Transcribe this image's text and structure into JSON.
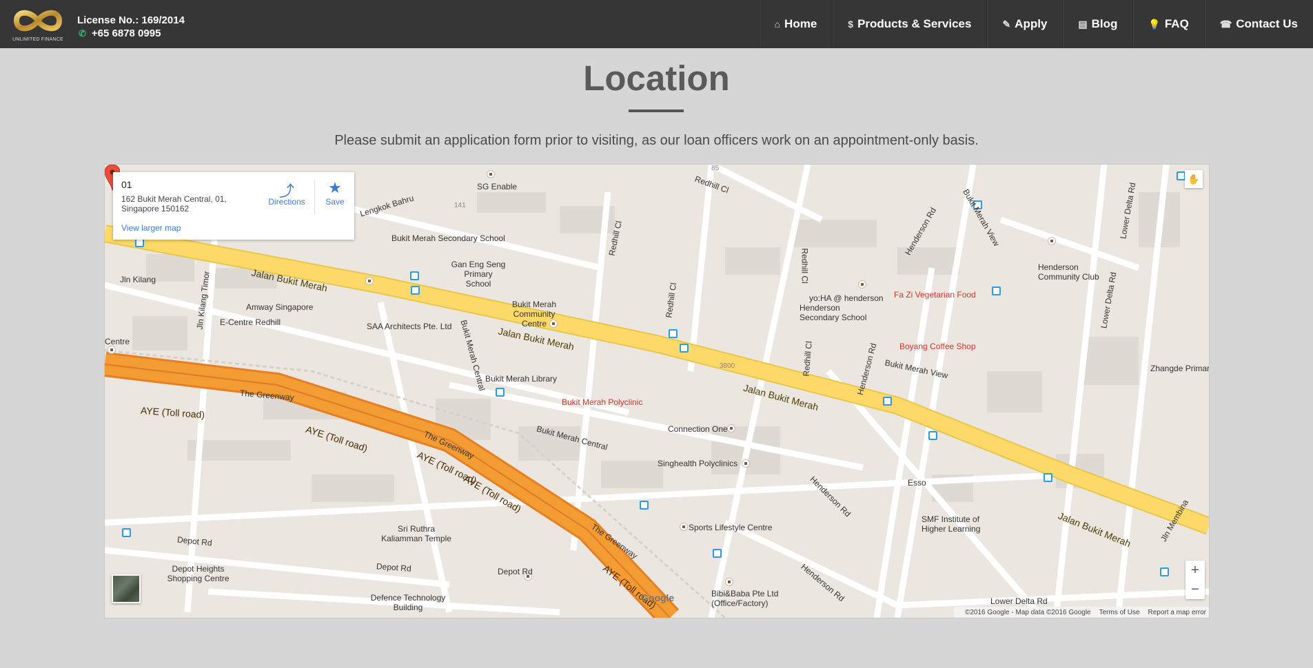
{
  "header": {
    "logo_text": "UNLIMITED FINANCE",
    "license": "License No.: 169/2014",
    "phone": "+65 6878 0995",
    "nav": [
      {
        "label": "Home",
        "icon": "home-icon"
      },
      {
        "label": "Products & Services",
        "icon": "dollar-icon"
      },
      {
        "label": "Apply",
        "icon": "edit-icon"
      },
      {
        "label": "Blog",
        "icon": "newspaper-icon"
      },
      {
        "label": "FAQ",
        "icon": "lightbulb-icon"
      },
      {
        "label": "Contact Us",
        "icon": "phone-icon"
      }
    ]
  },
  "page": {
    "title": "Location",
    "subtitle": "Please submit an application form prior to visiting, as our loan officers work on an appointment-only basis."
  },
  "map": {
    "info": {
      "title": "01",
      "address": "162 Bukit Merah Central, 01, Singapore 150162",
      "directions": "Directions",
      "save": "Save",
      "larger_map": "View larger map"
    },
    "labels": {
      "sg_enable": "SG Enable",
      "lengkok": "Lengkok Bahru",
      "bm_sec": "Bukit Merah Secondary School",
      "gan_eng": "Gan Eng Seng Primary School",
      "redhill_cl": "Redhill Cl",
      "jln_kilang": "Jln Kilang",
      "jln_kilang_timor": "Jln Kilang Timor",
      "amway": "Amway Singapore",
      "ecentre": "E-Centre Redhill",
      "centre": "Centre",
      "saa": "SAA Architects Pte. Ltd",
      "bm_comm": "Bukit Merah Community Centre",
      "jbm1": "Jalan Bukit Merah",
      "jbm2": "Jalan Bukit Merah",
      "jbm3": "Jalan Bukit Merah",
      "jbm4": "Jalan Bukit Merah",
      "bm_library": "Bukit Merah Library",
      "bm_poly": "Bukit Merah Polyclinic",
      "greenway1": "The Greenway",
      "greenway2": "The Greenway",
      "greenway3": "The Greenway",
      "aye1": "AYE (Toll road)",
      "aye2": "AYE (Toll road)",
      "aye3": "AYE (Toll road)",
      "aye4": "AYE (Toll road)",
      "aye5": "AYE (Toll road)",
      "bm_central1": "Bukit Merah Central",
      "bm_central2": "Bukit Merah Central",
      "connection_one": "Connection One",
      "singhealth": "Singhealth Polyclinics",
      "sports": "Sports Lifestyle Centre",
      "sri": "Sri Ruthra Kaliamman Temple",
      "depot1": "Depot Rd",
      "depot2": "Depot Rd",
      "depot3": "Depot Rd",
      "depot_heights": "Depot Heights Shopping Centre",
      "defence": "Defence Technology Building",
      "bibi": "Bibi&Baba Pte Ltd (Office/Factory)",
      "yoha": "yo:HA @ henderson",
      "henderson_sec": "Henderson Secondary School",
      "fazi": "Fa Zi Vegetarian Food",
      "boyang": "Boyang Coffee Shop",
      "bm_view1": "Bukit Merah View",
      "bm_view2": "Bukit Merah View",
      "henderson_cc": "Henderson Community Club",
      "lower_delta1": "Lower Delta Rd",
      "lower_delta2": "Lower Delta Rd",
      "lower_delta3": "Lower Delta Rd",
      "zhangde": "Zhangde Primary",
      "henderson_rd1": "Henderson Rd",
      "henderson_rd2": "Henderson Rd",
      "henderson_rd3": "Henderson Rd",
      "henderson_rd4": "Henderson Rd",
      "esso": "Esso",
      "smf": "SMF Institute of Higher Learning",
      "jln_membina": "Jln Membina",
      "n141": "141",
      "n85": "85",
      "n3800": "3800"
    },
    "google": "Google",
    "attribution": "©2016 Google - Map data ©2016 Google",
    "terms": "Terms of Use",
    "report": "Report a map error"
  }
}
